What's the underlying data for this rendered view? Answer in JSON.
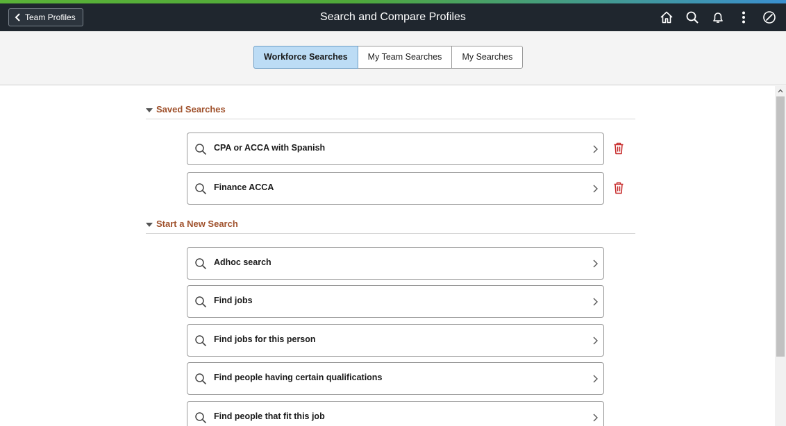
{
  "header": {
    "back_label": "Team Profiles",
    "title": "Search and Compare Profiles",
    "icons": [
      "home-icon",
      "search-icon",
      "bell-icon",
      "more-vertical-icon",
      "navbar-compass-icon"
    ]
  },
  "tabs": [
    {
      "label": "Workforce Searches",
      "active": true
    },
    {
      "label": "My Team Searches",
      "active": false
    },
    {
      "label": "My Searches",
      "active": false
    }
  ],
  "saved_searches": {
    "title": "Saved Searches",
    "items": [
      {
        "label": "CPA or ACCA with Spanish"
      },
      {
        "label": "Finance ACCA"
      }
    ]
  },
  "new_search": {
    "title": "Start a New Search",
    "items": [
      {
        "label": "Adhoc search"
      },
      {
        "label": "Find jobs"
      },
      {
        "label": "Find jobs for this person"
      },
      {
        "label": "Find people having certain qualifications"
      },
      {
        "label": "Find people that fit this job"
      }
    ]
  },
  "colors": {
    "banner": "#1f262e",
    "section_title": "#a0522d",
    "active_tab": "#bcdcf5",
    "delete_icon": "#c62828"
  }
}
